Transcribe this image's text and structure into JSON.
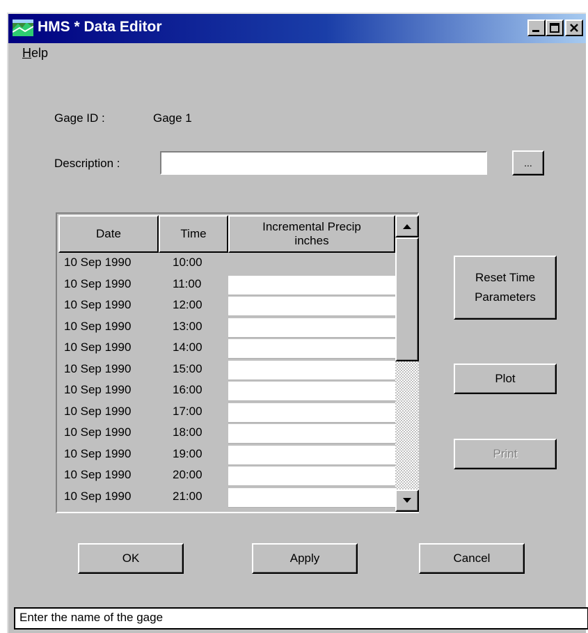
{
  "window": {
    "title": "HMS * Data Editor"
  },
  "menu": {
    "help_label": "Help"
  },
  "form": {
    "gage_id_label": "Gage ID :",
    "gage_id_value": "Gage 1",
    "description_label": "Description :",
    "description_value": "",
    "browse_label": "..."
  },
  "table": {
    "headers": [
      "Date",
      "Time",
      "Incremental Precip\ninches"
    ],
    "rows": [
      {
        "date": "10 Sep 1990",
        "time": "10:00",
        "value": ""
      },
      {
        "date": "10 Sep 1990",
        "time": "11:00",
        "value": ""
      },
      {
        "date": "10 Sep 1990",
        "time": "12:00",
        "value": ""
      },
      {
        "date": "10 Sep 1990",
        "time": "13:00",
        "value": ""
      },
      {
        "date": "10 Sep 1990",
        "time": "14:00",
        "value": ""
      },
      {
        "date": "10 Sep 1990",
        "time": "15:00",
        "value": ""
      },
      {
        "date": "10 Sep 1990",
        "time": "16:00",
        "value": ""
      },
      {
        "date": "10 Sep 1990",
        "time": "17:00",
        "value": ""
      },
      {
        "date": "10 Sep 1990",
        "time": "18:00",
        "value": ""
      },
      {
        "date": "10 Sep 1990",
        "time": "19:00",
        "value": ""
      },
      {
        "date": "10 Sep 1990",
        "time": "20:00",
        "value": ""
      },
      {
        "date": "10 Sep 1990",
        "time": "21:00",
        "value": ""
      }
    ]
  },
  "side_buttons": {
    "reset_label": "Reset Time\nParameters",
    "plot_label": "Plot",
    "print_label": "Print"
  },
  "footer_buttons": {
    "ok": "OK",
    "apply": "Apply",
    "cancel": "Cancel"
  },
  "status": {
    "text": "Enter the name of the gage"
  },
  "colors": {
    "title_start": "#000080",
    "title_end": "#a6caf0",
    "face": "#c0c0c0",
    "disabled_text": "#808080"
  }
}
